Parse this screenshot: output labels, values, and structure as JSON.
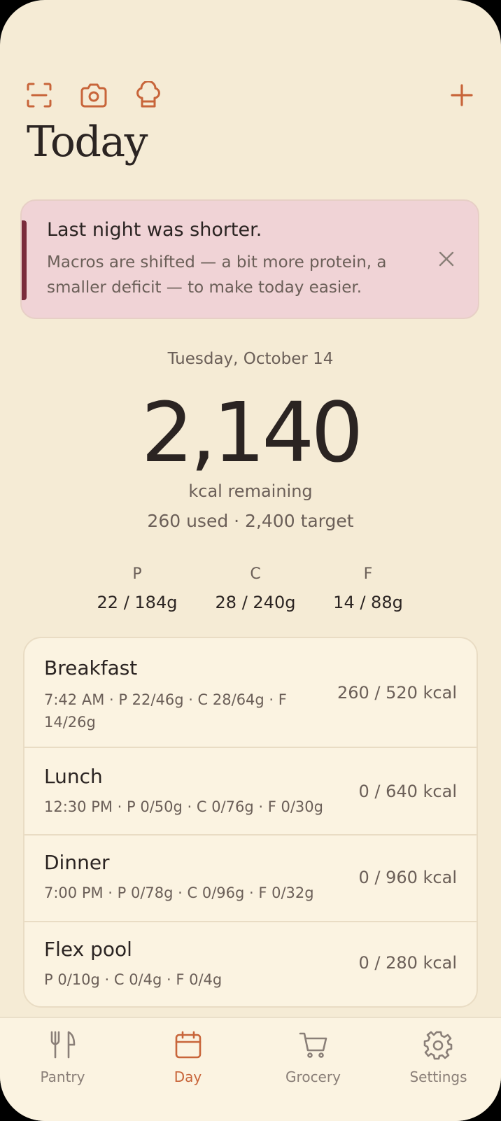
{
  "colors": {
    "accent": "#c8653a",
    "background": "#f5ebd5",
    "banner": "#f0d3d6",
    "banner_accent": "#7a2c3c"
  },
  "header": {
    "title": "Today",
    "icons": [
      "scan-icon",
      "camera-icon",
      "chef-hat-icon",
      "plus-icon"
    ]
  },
  "banner": {
    "title": "Last night was shorter.",
    "body": "Macros are shifted — a bit more protein, a smaller deficit — to make today easier."
  },
  "summary": {
    "date": "Tuesday, October 14",
    "remaining": "2,140",
    "remaining_label": "kcal remaining",
    "usage": "260 used · 2,400 target"
  },
  "macros": [
    {
      "letter": "P",
      "value": "22 / 184g"
    },
    {
      "letter": "C",
      "value": "28 / 240g"
    },
    {
      "letter": "F",
      "value": "14 / 88g"
    }
  ],
  "meals": [
    {
      "name": "Breakfast",
      "detail": "7:42 AM · P 22/46g · C 28/64g · F 14/26g",
      "kcal": "260 / 520 kcal"
    },
    {
      "name": "Lunch",
      "detail": "12:30 PM · P 0/50g · C 0/76g · F 0/30g",
      "kcal": "0 / 640 kcal"
    },
    {
      "name": "Dinner",
      "detail": "7:00 PM · P 0/78g · C 0/96g · F 0/32g",
      "kcal": "0 / 960 kcal"
    },
    {
      "name": "Flex pool",
      "detail": "P 0/10g · C 0/4g · F 0/4g",
      "kcal": "0 / 280 kcal"
    }
  ],
  "nav": [
    {
      "label": "Pantry",
      "icon": "fork-knife-icon",
      "active": false
    },
    {
      "label": "Day",
      "icon": "calendar-icon",
      "active": true
    },
    {
      "label": "Grocery",
      "icon": "cart-icon",
      "active": false
    },
    {
      "label": "Settings",
      "icon": "gear-icon",
      "active": false
    }
  ]
}
